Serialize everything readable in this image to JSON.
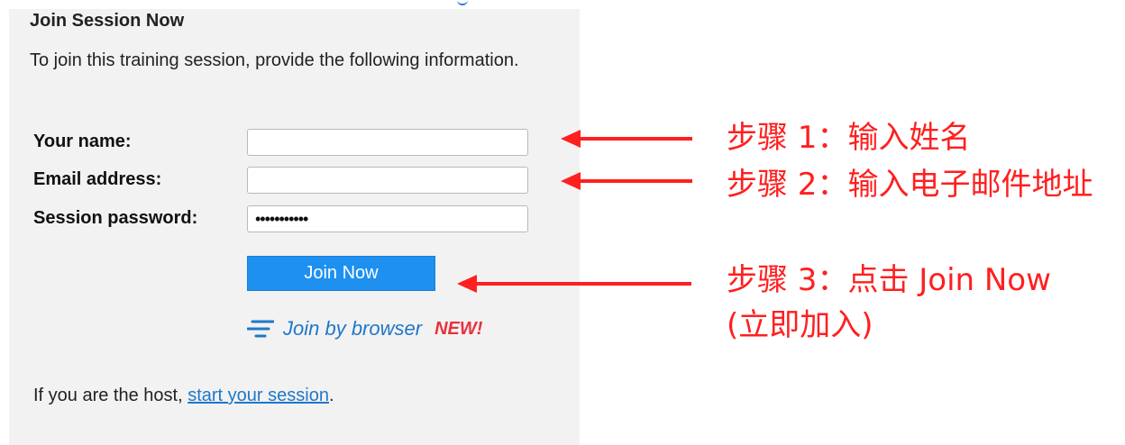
{
  "form": {
    "title": "Join Session Now",
    "intro": "To join this training session, provide the following information.",
    "fields": [
      {
        "label": "Your name:",
        "value": "",
        "placeholder": ""
      },
      {
        "label": "Email address:",
        "value": "",
        "placeholder": ""
      },
      {
        "label": "Session password:",
        "value": "•••••••••••",
        "placeholder": ""
      }
    ],
    "join_button": "Join Now",
    "browser_link": "Join by browser",
    "new_badge": "NEW!",
    "host_prefix": "If you are the host, ",
    "host_link": "start your session",
    "host_suffix": "."
  },
  "annotations": [
    {
      "text": "步骤 1：输入姓名"
    },
    {
      "text": "步骤 2：输入电子邮件地址"
    },
    {
      "line1": "步骤 3：点击 Join Now",
      "line2": "(立即加入)"
    }
  ],
  "colors": {
    "panel_bg": "#f2f2f2",
    "button_bg": "#1e90f0",
    "link": "#1f77c9",
    "new_badge": "#e8323c",
    "annotation": "#ff1f1f"
  },
  "icons": {
    "browser": "join-by-browser-icon",
    "arrow": "left-arrow-icon"
  }
}
